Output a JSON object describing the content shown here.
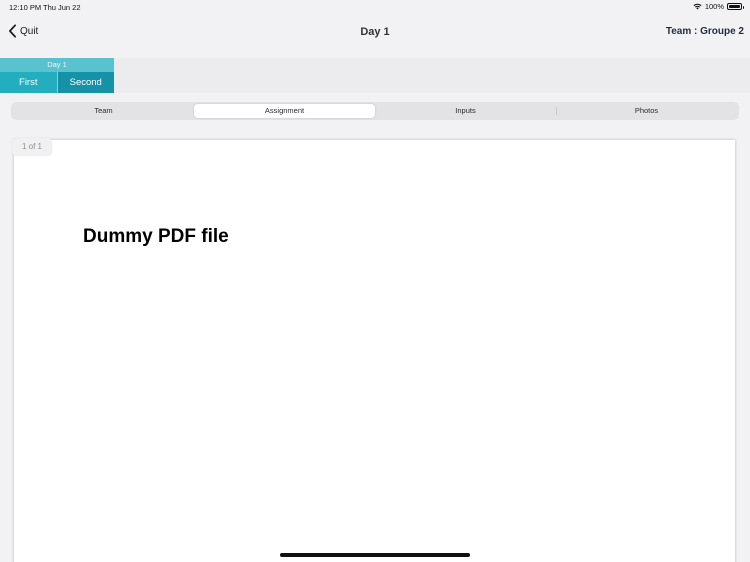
{
  "status_bar": {
    "time": "12:10 PM",
    "date": "Thu Jun 22",
    "battery": "100%"
  },
  "nav": {
    "back_label": "Quit",
    "title": "Day 1",
    "team_label": "Team : Groupe 2"
  },
  "day_selector": {
    "header": "Day 1",
    "tabs": [
      {
        "label": "First"
      },
      {
        "label": "Second"
      }
    ]
  },
  "segments": [
    {
      "label": "Team"
    },
    {
      "label": "Assignment",
      "active": true
    },
    {
      "label": "Inputs"
    },
    {
      "label": "Photos"
    }
  ],
  "pdf": {
    "page_indicator": "1 of 1",
    "heading": "Dummy PDF file"
  },
  "colors": {
    "day_header": "#59c2cf",
    "tab_first": "#22aebe",
    "tab_second": "#1591a8"
  }
}
